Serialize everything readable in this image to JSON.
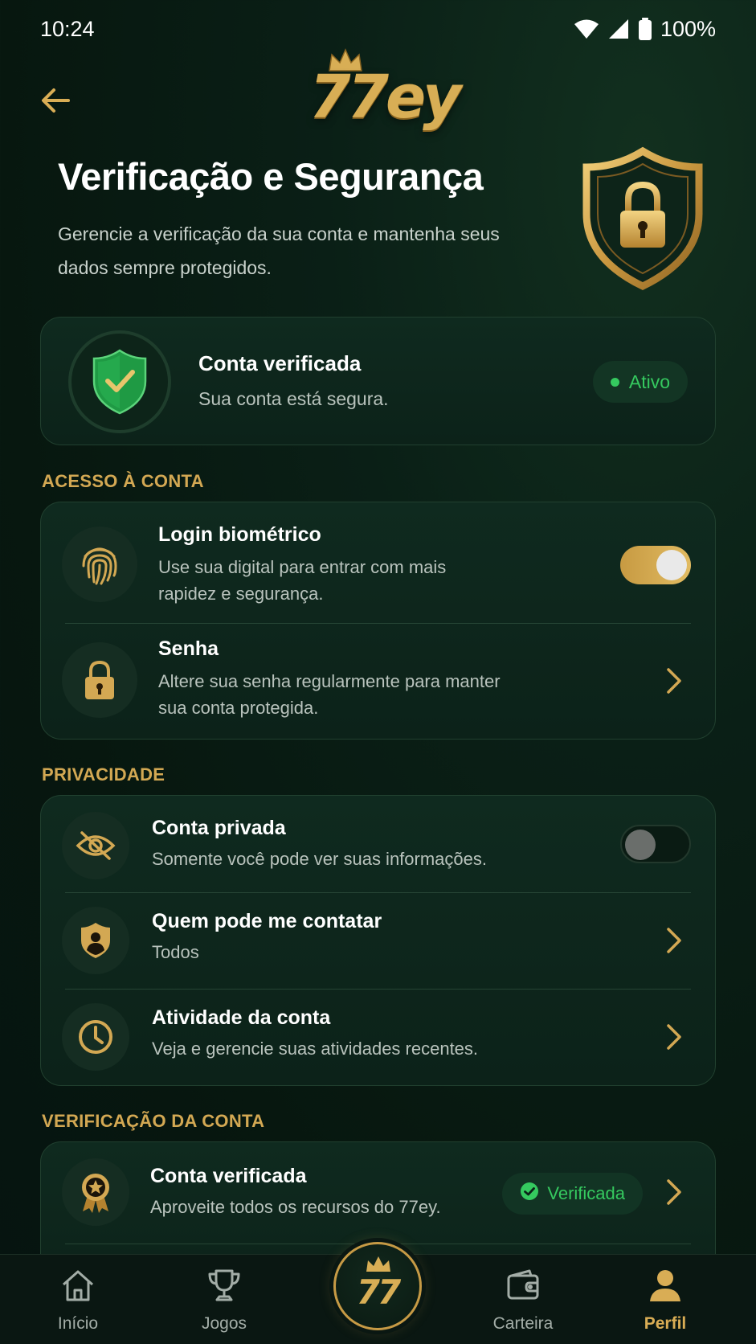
{
  "status_bar": {
    "time": "10:24",
    "battery": "100%"
  },
  "header": {
    "logo_text": "77ey"
  },
  "hero": {
    "title": "Verificação e Segurança",
    "subtitle": "Gerencie a verificação da sua conta e mantenha seus dados sempre protegidos."
  },
  "account_status": {
    "title": "Conta verificada",
    "subtitle": "Sua conta está segura.",
    "badge": "Ativo"
  },
  "sections": {
    "access": {
      "label": "ACESSO À CONTA",
      "items": [
        {
          "title": "Login biométrico",
          "subtitle": "Use sua digital para entrar com mais rapidez e segurança.",
          "toggle": true
        },
        {
          "title": "Senha",
          "subtitle": "Altere sua senha regularmente para manter sua conta protegida."
        }
      ]
    },
    "privacy": {
      "label": "PRIVACIDADE",
      "items": [
        {
          "title": "Conta privada",
          "subtitle": "Somente você pode ver suas informações.",
          "toggle": false
        },
        {
          "title": "Quem pode me contatar",
          "subtitle": "Todos"
        },
        {
          "title": "Atividade da conta",
          "subtitle": "Veja e gerencie suas atividades recentes."
        }
      ]
    },
    "verification": {
      "label": "VERIFICAÇÃO DA CONTA",
      "items": [
        {
          "title": "Conta verificada",
          "subtitle": "Aproveite todos os recursos do 77ey.",
          "badge": "Verificada"
        }
      ]
    }
  },
  "bottom_nav": {
    "items": [
      {
        "label": "Início",
        "icon": "home-icon"
      },
      {
        "label": "Jogos",
        "icon": "trophy-icon"
      },
      {
        "label": "Carteira",
        "icon": "wallet-icon"
      },
      {
        "label": "Perfil",
        "icon": "user-icon",
        "active": true
      }
    ],
    "center_text": "77"
  },
  "colors": {
    "gold": "#d9ad55",
    "green": "#35c95f",
    "background": "#07170f"
  }
}
